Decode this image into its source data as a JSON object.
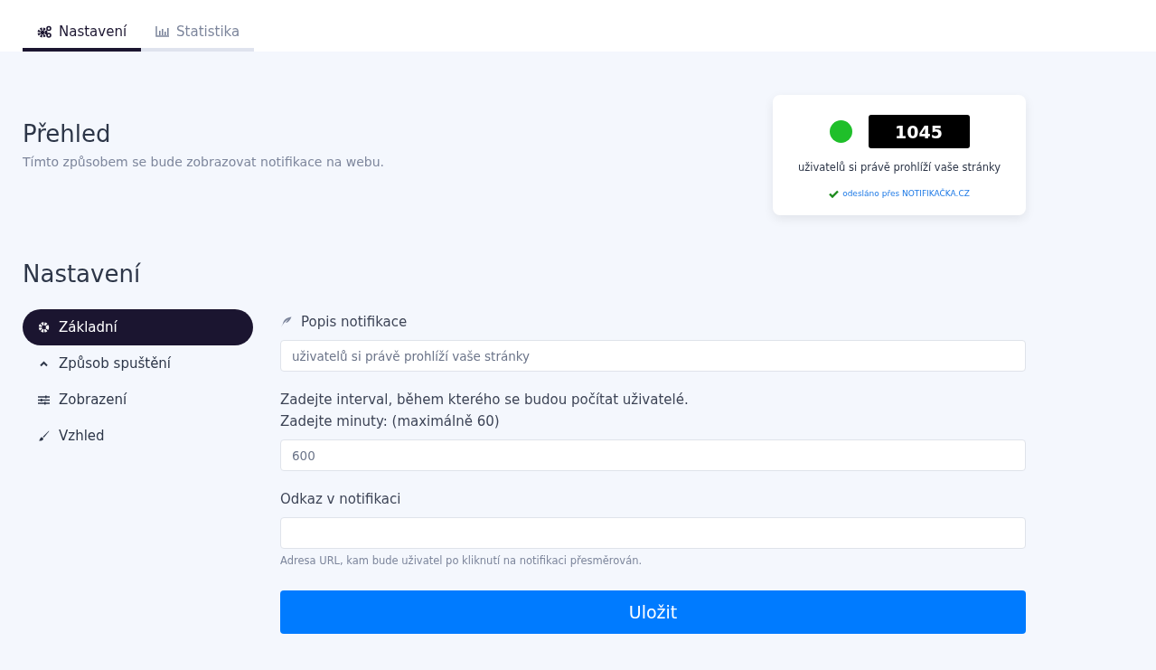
{
  "tabs": [
    {
      "label": "Nastavení",
      "selected": true
    },
    {
      "label": "Statistika",
      "selected": false
    }
  ],
  "overview": {
    "title": "Přehled",
    "subtitle": "Tímto způsobem se bude zobrazovat notifikace na webu."
  },
  "preview": {
    "status": {
      "color": "#1fbf2a"
    },
    "count": "1045",
    "message": "uživatelů si právě prohlíží vaše stránky",
    "credit": "odesláno přes NOTIFIKAČKA.CZ"
  },
  "settings": {
    "title": "Nastavení",
    "menu": [
      {
        "label": "Základní",
        "selected": true
      },
      {
        "label": "Způsob spuštění",
        "selected": false
      },
      {
        "label": "Zobrazení",
        "selected": false
      },
      {
        "label": "Vzhled",
        "selected": false
      }
    ],
    "description": {
      "label": "Popis notifikace",
      "value": "uživatelů si právě prohlíží vaše stránky"
    },
    "interval": {
      "label_lines": [
        "Zadejte interval, během kterého se budou počítat uživatelé.",
        "Zadejte minuty: (maximálně 60)"
      ],
      "value": "600"
    },
    "link": {
      "label": "Odkaz v notifikaci",
      "hint": "Adresa URL, kam bude uživatel po kliknutí na notifikaci přesměrován."
    },
    "save": "Uložit"
  }
}
